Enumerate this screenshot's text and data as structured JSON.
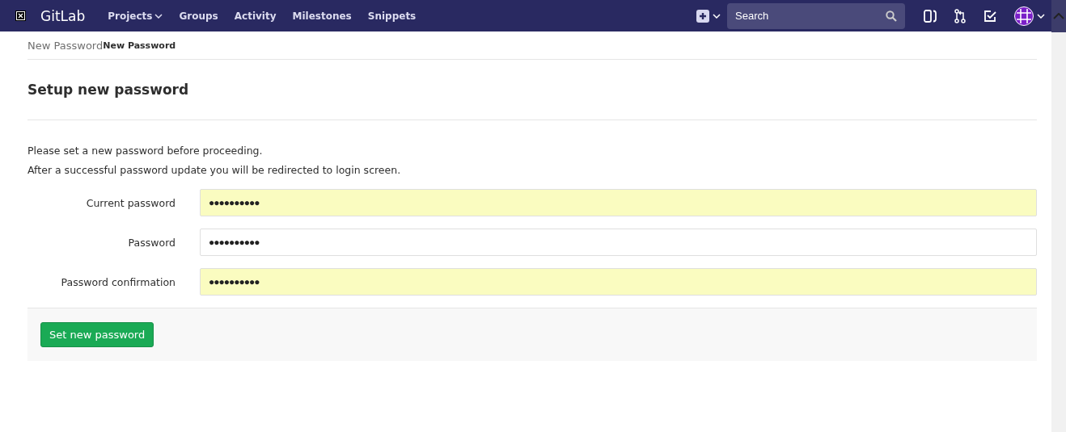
{
  "navbar": {
    "brand": "GitLab",
    "links": [
      {
        "label": "Projects",
        "dropdown": true
      },
      {
        "label": "Groups",
        "dropdown": false
      },
      {
        "label": "Activity",
        "dropdown": false
      },
      {
        "label": "Milestones",
        "dropdown": false
      },
      {
        "label": "Snippets",
        "dropdown": false
      }
    ],
    "search": {
      "placeholder": "Search"
    }
  },
  "breadcrumb": [
    "New Password",
    "New Password"
  ],
  "title": "Setup new password",
  "intro": [
    "Please set a new password before proceeding.",
    "After a successful password update you will be redirected to login screen."
  ],
  "fields": [
    {
      "label": "Current password",
      "value": "●●●●●●●●●●",
      "autofilled": true
    },
    {
      "label": "Password",
      "value": "●●●●●●●●●●",
      "autofilled": false
    },
    {
      "label": "Password confirmation",
      "value": "●●●●●●●●●●",
      "autofilled": true
    }
  ],
  "submit": "Set new password"
}
